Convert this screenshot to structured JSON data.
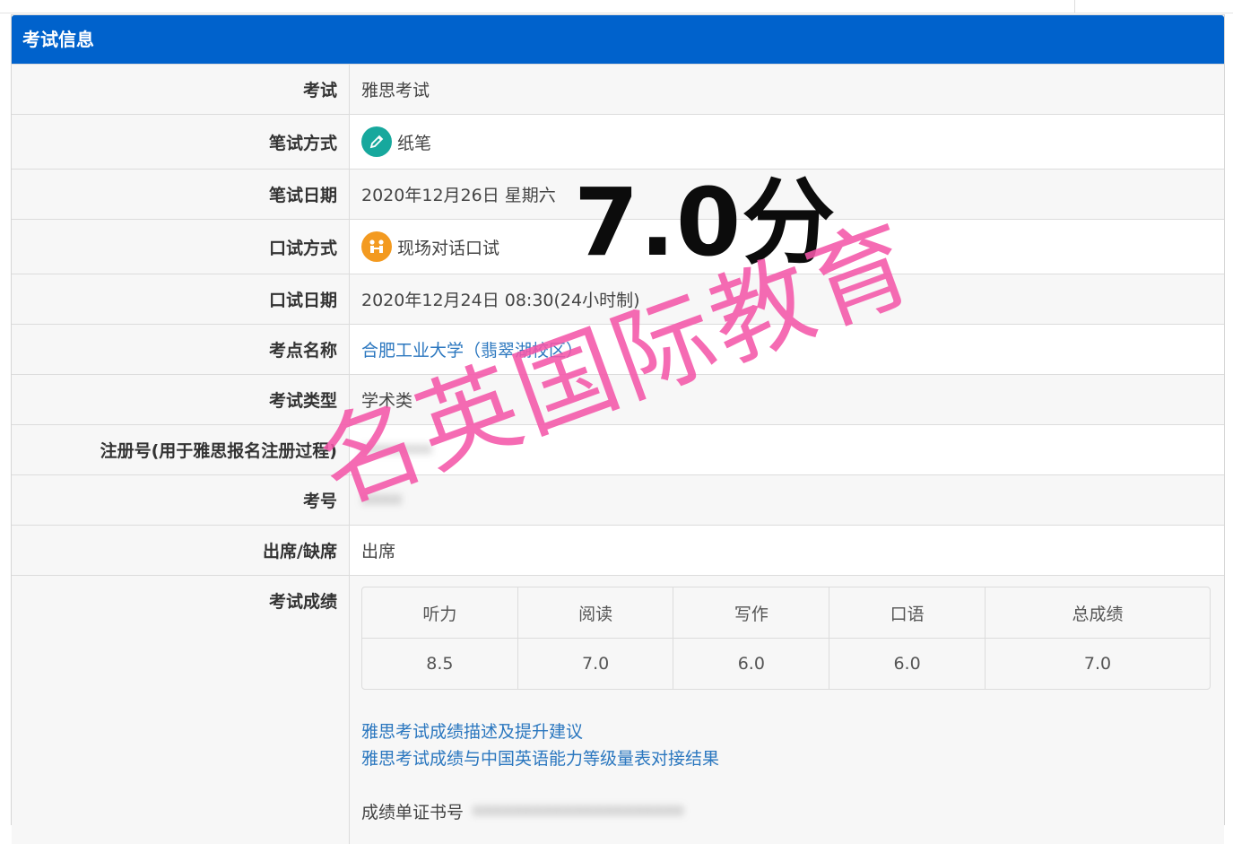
{
  "panel": {
    "title": "考试信息"
  },
  "rows": {
    "exam": {
      "label": "考试",
      "value": "雅思考试"
    },
    "written_mode": {
      "label": "笔试方式",
      "value": "纸笔",
      "icon": "pencil-icon"
    },
    "written_date": {
      "label": "笔试日期",
      "value": "2020年12月26日 星期六"
    },
    "speaking_mode": {
      "label": "口试方式",
      "value": "现场对话口试",
      "icon": "people-icon"
    },
    "speaking_date": {
      "label": "口试日期",
      "value": "2020年12月24日 08:30(24小时制)"
    },
    "center": {
      "label": "考点名称",
      "value": "合肥工业大学（翡翠湖校区）"
    },
    "type": {
      "label": "考试类型",
      "value": "学术类"
    },
    "registration": {
      "label": "注册号(用于雅思报名注册过程)",
      "value": "•••••••"
    },
    "candidate_no": {
      "label": "考号",
      "value": "••••"
    },
    "attendance": {
      "label": "出席/缺席",
      "value": "出席"
    },
    "scores": {
      "label": "考试成绩"
    }
  },
  "score_table": {
    "headers": [
      "听力",
      "阅读",
      "写作",
      "口语",
      "总成绩"
    ],
    "values": [
      "8.5",
      "7.0",
      "6.0",
      "6.0",
      "7.0"
    ]
  },
  "links": {
    "advice": "雅思考试成绩描述及提升建议",
    "cse": "雅思考试成绩与中国英语能力等级量表对接结果"
  },
  "certificate": {
    "label": "成绩单证书号",
    "value": "•••••••••••••••••••••"
  },
  "overlay": {
    "score": "7.0分",
    "watermark": "名英国际教育"
  },
  "colors": {
    "header": "#0062cc",
    "link": "#2b77bf",
    "watermark": "#f456a8"
  }
}
